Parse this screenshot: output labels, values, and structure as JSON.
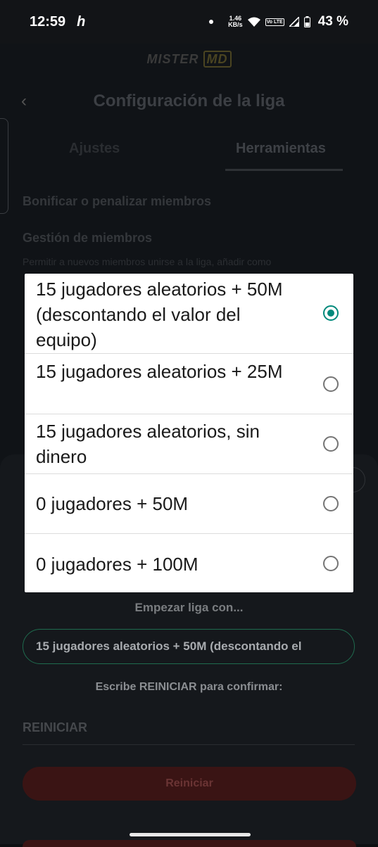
{
  "status_bar": {
    "time": "12:59",
    "app_glyph": "h",
    "speed_value": "1.46",
    "speed_unit": "KB/s",
    "volte": "Vo LTE",
    "battery_percent": "43 %"
  },
  "app": {
    "logo_text": "MISTER",
    "logo_badge": "MD",
    "title": "Configuración de la liga",
    "tabs": [
      {
        "label": "Ajustes",
        "selected": false
      },
      {
        "label": "Herramientas",
        "selected": true
      }
    ],
    "section_bonify": "Bonificar o penalizar miembros",
    "section_members": "Gestión de miembros",
    "section_members_desc": "Permitir a nuevos miembros unirse a la liga, añadir como"
  },
  "sheet": {
    "start_label": "Empezar liga con...",
    "selected_value": "15 jugadores aleatorios + 50M (descontando el",
    "confirm_label": "Escribe REINICIAR para confirmar:",
    "confirm_placeholder": "REINICIAR",
    "reset_button": "Reiniciar"
  },
  "dialog": {
    "options": [
      {
        "label": "15 jugadores aleatorios + 50M (descontando el valor del equipo)",
        "checked": true
      },
      {
        "label": "15 jugadores aleatorios + 25M",
        "checked": false
      },
      {
        "label": "15 jugadores aleatorios, sin dinero",
        "checked": false
      },
      {
        "label": "0 jugadores + 50M",
        "checked": false
      },
      {
        "label": "0 jugadores + 100M",
        "checked": false
      }
    ]
  },
  "colors": {
    "accent": "#00897b",
    "danger_dim": "#3a1414"
  }
}
